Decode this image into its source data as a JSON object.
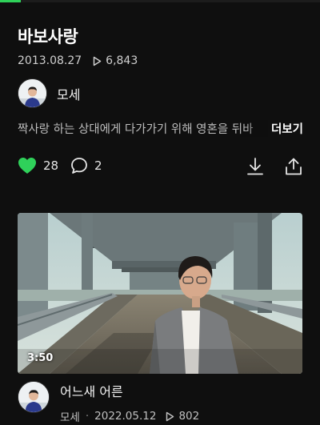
{
  "playback": {
    "progress_fraction": 0.065,
    "accent": "#2fd15a"
  },
  "post": {
    "title": "바보사랑",
    "date": "2013.08.27",
    "views": "6,843",
    "author": "모세",
    "description": "짝사랑 하는 상대에게 다가가기 위해 영혼을 뒤바",
    "more_label": "더보기"
  },
  "actions": {
    "likes": "28",
    "comments": "2",
    "like_icon": "heart-icon",
    "comment_icon": "comment-bubble-icon",
    "download_icon": "download-icon",
    "share_icon": "share-icon"
  },
  "next_video": {
    "duration": "3:50",
    "title": "어느새 어른",
    "author": "모세",
    "date": "2022.05.12",
    "views": "802"
  }
}
